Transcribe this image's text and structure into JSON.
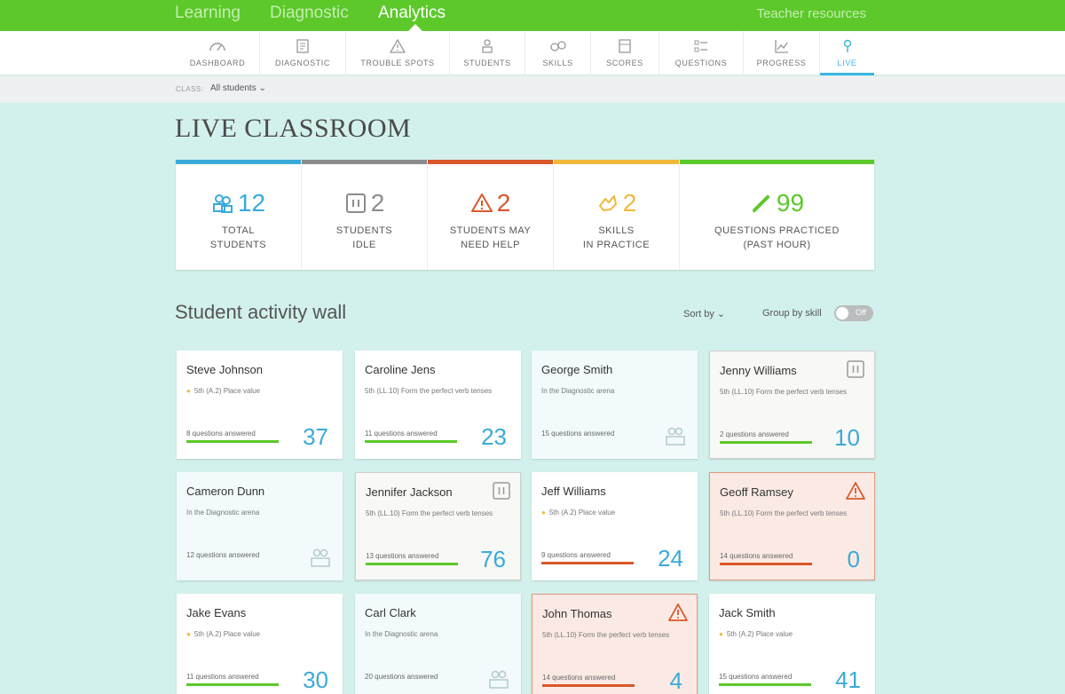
{
  "topnav": {
    "items": [
      "Learning",
      "Diagnostic",
      "Analytics"
    ],
    "active": "Analytics",
    "resources": "Teacher resources"
  },
  "tabs": [
    "DASHBOARD",
    "DIAGNOSTIC",
    "TROUBLE SPOTS",
    "STUDENTS",
    "SKILLS",
    "SCORES",
    "QUESTIONS",
    "PROGRESS",
    "LIVE"
  ],
  "active_tab": "LIVE",
  "class_filter": {
    "label": "CLASS:",
    "value": "All students ⌄"
  },
  "page_title": "LIVE CLASSROOM",
  "stats": [
    {
      "icon": "students-icon",
      "number": "12",
      "label1": "TOTAL",
      "label2": "STUDENTS",
      "color": "#3aaad9"
    },
    {
      "icon": "pause-icon",
      "number": "2",
      "label1": "STUDENTS",
      "label2": "IDLE",
      "color": "#8c8c8c"
    },
    {
      "icon": "warning-icon",
      "number": "2",
      "label1": "STUDENTS MAY",
      "label2": "NEED HELP",
      "color": "#d9572b"
    },
    {
      "icon": "skills-icon",
      "number": "2",
      "label1": "SKILLS",
      "label2": "IN PRACTICE",
      "color": "#f0b93b"
    },
    {
      "icon": "pencil-icon",
      "number": "99",
      "label1": "QUESTIONS PRACTICED",
      "label2": "(PAST HOUR)",
      "color": "#5cc82a"
    }
  ],
  "wall": {
    "title": "Student activity wall",
    "sort_label": "Sort by ⌄",
    "group_label": "Group by skill",
    "toggle_label": "Off"
  },
  "students": [
    {
      "name": "Steve Johnson",
      "desc": "5th (A.2) Place value",
      "dot": true,
      "answered": "8 questions answered",
      "number": "37",
      "state": "normal",
      "line": "#5cc82a"
    },
    {
      "name": "Caroline Jens",
      "desc": "5th (LL.10) Form the perfect verb tenses",
      "dot": false,
      "answered": "11 questions answered",
      "number": "23",
      "state": "normal",
      "line": "#5cc82a"
    },
    {
      "name": "George Smith",
      "desc": "In the Diagnostic arena",
      "dot": false,
      "answered": "15 questions answered",
      "number": "",
      "state": "diag",
      "line": ""
    },
    {
      "name": "Jenny Williams",
      "desc": "5th (LL.10) Form the perfect verb tenses",
      "dot": false,
      "answered": "2 questions answered",
      "number": "10",
      "state": "idle",
      "line": "#5cc82a"
    },
    {
      "name": "Cameron Dunn",
      "desc": "In the Diagnostic arena",
      "dot": false,
      "answered": "12 questions answered",
      "number": "",
      "state": "diag",
      "line": ""
    },
    {
      "name": "Jennifer Jackson",
      "desc": "5th (LL.10) Form the perfect verb tenses",
      "dot": false,
      "answered": "13 questions answered",
      "number": "76",
      "state": "idle",
      "line": "#5cc82a"
    },
    {
      "name": "Jeff Williams",
      "desc": "5th (A.2) Place value",
      "dot": true,
      "answered": "9 questions answered",
      "number": "24",
      "state": "normal",
      "line": "#d9572b"
    },
    {
      "name": "Geoff Ramsey",
      "desc": "5th (LL.10) Form the perfect verb tenses",
      "dot": false,
      "answered": "14 questions answered",
      "number": "0",
      "state": "help",
      "line": "#d9572b"
    },
    {
      "name": "Jake Evans",
      "desc": "5th (A.2) Place value",
      "dot": true,
      "answered": "11 questions answered",
      "number": "30",
      "state": "normal",
      "line": "#5cc82a"
    },
    {
      "name": "Carl Clark",
      "desc": "In the Diagnostic arena",
      "dot": false,
      "answered": "20 questions answered",
      "number": "",
      "state": "diag",
      "line": ""
    },
    {
      "name": "John Thomas",
      "desc": "5th (LL.10) Form the perfect verb tenses",
      "dot": false,
      "answered": "14 questions answered",
      "number": "4",
      "state": "help",
      "line": "#d9572b"
    },
    {
      "name": "Jack Smith",
      "desc": "5th (A.2) Place value",
      "dot": true,
      "answered": "15 questions answered",
      "number": "41",
      "state": "normal",
      "line": "#5cc82a"
    }
  ]
}
